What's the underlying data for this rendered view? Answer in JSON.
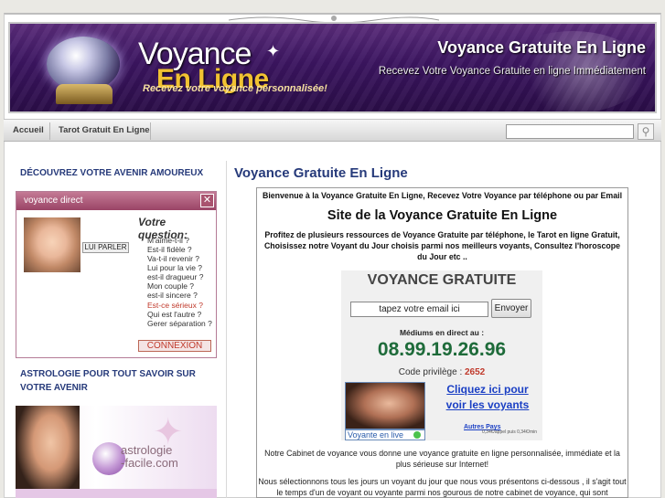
{
  "banner": {
    "logo_line1": "Voyance",
    "logo_line2": "En Ligne",
    "logo_tagline": "Recevez votre voyance personnalisée!",
    "title": "Voyance Gratuite En Ligne",
    "subtitle": "Recevez Votre Voyance Gratuite en ligne Immédiatement"
  },
  "nav": {
    "items": [
      {
        "label": "Accueil"
      },
      {
        "label": "Tarot Gratuit En Ligne"
      }
    ],
    "search_value": ""
  },
  "sidebar": {
    "heading1": "DÉCOUVREZ VOTRE AVENIR AMOUREUX",
    "widget": {
      "title": "voyance direct",
      "close": "✕",
      "lui_parler": "LUI PARLER",
      "question_label": "Votre question:",
      "questions": [
        {
          "text": "M'aime-t-il ?"
        },
        {
          "text": "Est-il fidèle ?"
        },
        {
          "text": "Va-t-il revenir ?"
        },
        {
          "text": "Lui pour la vie ?"
        },
        {
          "text": "est-il dragueur ?"
        },
        {
          "text": "Mon couple ?"
        },
        {
          "text": "est-il sincere ?"
        },
        {
          "text": "Est-ce sérieux ?"
        },
        {
          "text": "Qui est l'autre ?"
        },
        {
          "text": "Gerer séparation ?"
        }
      ],
      "connexion": "CONNEXION"
    },
    "heading2_line1": "ASTROLOGIE POUR TOUT SAVOIR SUR",
    "heading2_line2": "VOTRE AVENIR",
    "astro_text_line1": "astrologie",
    "astro_text_line2": "-facile.com"
  },
  "main": {
    "heading": "Voyance Gratuite En Ligne",
    "welcome": "Bienvenue à la Voyance Gratuite En Ligne, Recevez Votre Voyance par téléphone ou par Email",
    "site_title": "Site de la Voyance Gratuite En Ligne",
    "intro": "Profitez de plusieurs ressources de Voyance Gratuite par téléphone, le Tarot en ligne Gratuit, Choisissez notre Voyant du Jour choisis parmi nos meilleurs voyants, Consultez l'horoscope du Jour etc ..",
    "vg": {
      "title": "VOYANCE GRATUITE",
      "email_placeholder": "tapez votre email ici",
      "send": "Envoyer",
      "mediums": "Médiums en direct au :",
      "phone": "08.99.19.26.96",
      "code_label": "Code privilège :",
      "code": "2652",
      "live": "Voyante en live",
      "link_line1": "Cliquez ici pour",
      "link_line2": "voir les voyants",
      "autres": "Autres Pays",
      "tarif": "0,34€/appel puis 0,34€/min"
    },
    "para1": "Notre Cabinet de voyance vous donne une voyance gratuite en ligne personnalisée, immédiate et la plus sérieuse sur Internet!",
    "para2": "Nous sélectionnons tous les jours un voyant du jour que nous vous présentons ci-dessous , il s'agit tout le temps d'un de voyant ou voyante parmi nos gourous de notre cabinet de voyance, qui sont"
  },
  "colors": {
    "banner_purple": "#3b1560",
    "heading_blue": "#263a7a",
    "phone_green": "#1e6b3a",
    "link_blue": "#1a3fc4",
    "widget_pink": "#9a4466"
  }
}
